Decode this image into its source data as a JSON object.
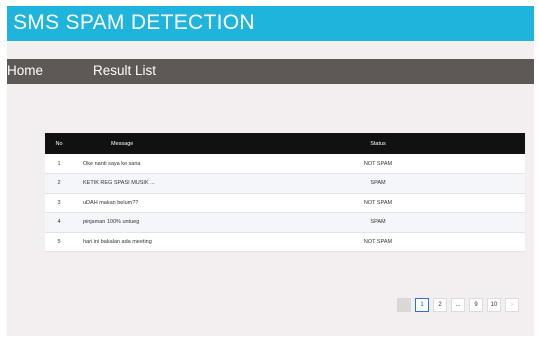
{
  "app": {
    "title": "SMS SPAM DETECTION"
  },
  "nav": {
    "home": "Home",
    "results": "Result List"
  },
  "table": {
    "headers": {
      "no": "No",
      "message": "Message",
      "status": "Status"
    },
    "rows": [
      {
        "no": "1",
        "message": "Oke nanti saya ke sana",
        "status": "NOT SPAM"
      },
      {
        "no": "2",
        "message": "KETIK REG SPASI MUSIK ...",
        "status": "SPAM"
      },
      {
        "no": "3",
        "message": "uDAH makan belum??",
        "status": "NOT SPAM"
      },
      {
        "no": "4",
        "message": "pinjaman 100% untueg",
        "status": "SPAM"
      },
      {
        "no": "5",
        "message": "hari ini bakalan ada meeting",
        "status": "NOT SPAM"
      }
    ]
  },
  "pagination": {
    "prev_icon": "‹",
    "pages": [
      "1",
      "2",
      "...",
      "9",
      "10"
    ],
    "active_page": "1",
    "next_icon": "›"
  },
  "colors": {
    "banner": "#1fb4dc",
    "navbar": "#5e5856",
    "background": "#f3eeef",
    "table_header": "#111111",
    "active_page_border": "#2e6fd8"
  }
}
